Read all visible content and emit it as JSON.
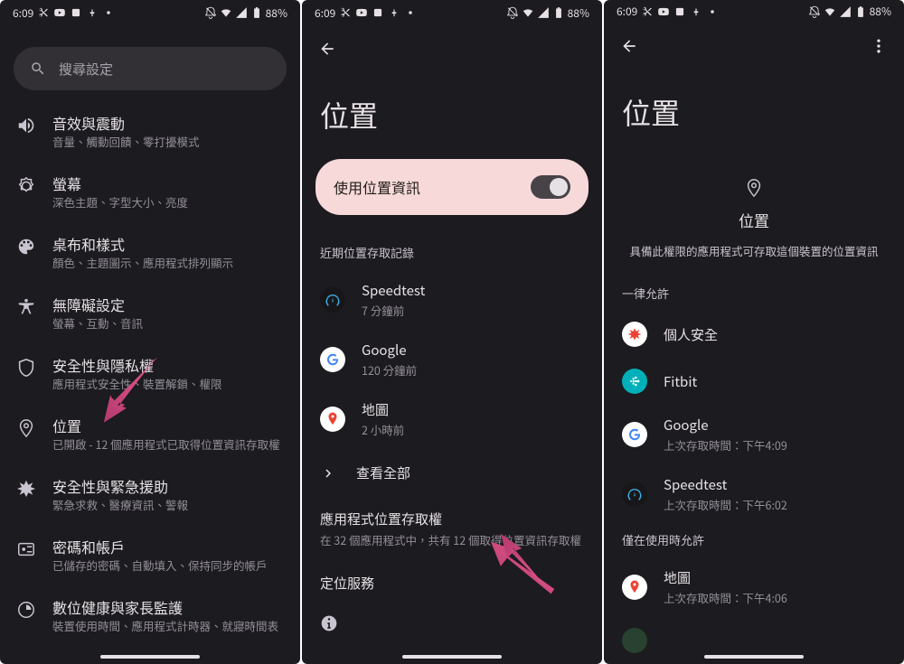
{
  "status": {
    "time": "6:09",
    "battery": "88%"
  },
  "screen1": {
    "search_placeholder": "搜尋設定",
    "items": [
      {
        "title": "音效與震動",
        "sub": "音量、觸動回饋、零打擾模式"
      },
      {
        "title": "螢幕",
        "sub": "深色主題、字型大小、亮度"
      },
      {
        "title": "桌布和樣式",
        "sub": "顏色、主題圖示、應用程式排列顯示"
      },
      {
        "title": "無障礙設定",
        "sub": "螢幕、互動、音訊"
      },
      {
        "title": "安全性與隱私權",
        "sub": "應用程式安全性、裝置解鎖、權限"
      },
      {
        "title": "位置",
        "sub": "已開啟 - 12 個應用程式已取得位置資訊存取權"
      },
      {
        "title": "安全性與緊急援助",
        "sub": "緊急求救、醫療資訊、警報"
      },
      {
        "title": "密碼和帳戶",
        "sub": "已儲存的密碼、自動填入、保持同步的帳戶"
      },
      {
        "title": "數位健康與家長監護",
        "sub": "裝置使用時間、應用程式計時器、就寢時間表"
      }
    ]
  },
  "screen2": {
    "title": "位置",
    "toggle_label": "使用位置資訊",
    "recent_label": "近期位置存取記錄",
    "apps": [
      {
        "name": "Speedtest",
        "time": "7 分鐘前"
      },
      {
        "name": "Google",
        "time": "120 分鐘前"
      },
      {
        "name": "地圖",
        "time": "2 小時前"
      }
    ],
    "see_all": "查看全部",
    "perm_title": "應用程式位置存取權",
    "perm_sub": "在 32 個應用程式中，共有 12 個取得位置資訊存取權",
    "services": "定位服務"
  },
  "screen3": {
    "title": "位置",
    "perm_name": "位置",
    "perm_desc": "具備此權限的應用程式可存取這個裝置的位置資訊",
    "allowed_label": "一律允許",
    "allowed": [
      {
        "name": "個人安全",
        "time": ""
      },
      {
        "name": "Fitbit",
        "time": ""
      },
      {
        "name": "Google",
        "time": "上次存取時間：下午4:09"
      },
      {
        "name": "Speedtest",
        "time": "上次存取時間：下午6:02"
      }
    ],
    "inuse_label": "僅在使用時允許",
    "inuse": [
      {
        "name": "地圖",
        "time": "上次存取時間：下午4:06"
      }
    ]
  }
}
